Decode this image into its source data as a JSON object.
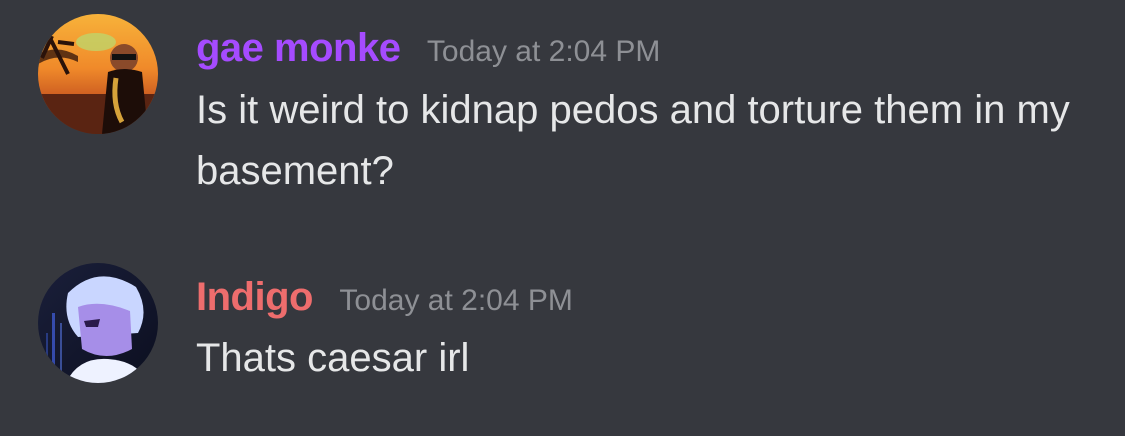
{
  "colors": {
    "background": "#36383e",
    "timestamp": "#8e9095",
    "message_text": "#e6e7e8"
  },
  "messages": [
    {
      "username": "gae monke",
      "username_color": "#a54bff",
      "timestamp": "Today at 2:04 PM",
      "text": "Is it weird to kidnap pedos and torture them in my basement?"
    },
    {
      "username": "Indigo",
      "username_color": "#ee6d6d",
      "timestamp": "Today at 2:04 PM",
      "text": "Thats caesar irl"
    }
  ]
}
